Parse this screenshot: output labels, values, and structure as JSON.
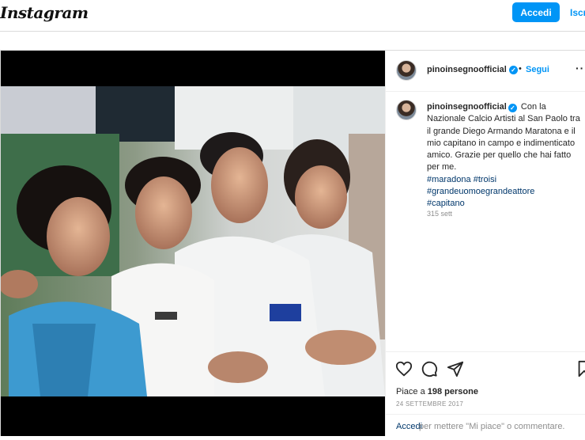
{
  "header": {
    "logo": "Instagram",
    "login_button": "Accedi",
    "signup_link": "Iscr"
  },
  "post": {
    "username": "pinoinsegnoofficial",
    "verified_mark": "✓",
    "dot": "•",
    "follow_label": "Segui",
    "more_label": "···",
    "caption": {
      "username": "pinoinsegnoofficial",
      "text": "Con la Nazionale Calcio Artisti al San Paolo tra il grande Diego Armando Maratona e il mio capitano in campo e indimenticato amico. Grazie per quello che hai fatto per me.",
      "hashtags": [
        "#maradona #troisi",
        "#grandeuomoegrandeattore",
        "#capitano"
      ],
      "time_ago": "315 sett"
    },
    "likes": {
      "prefix": "Piace a ",
      "count": "198 persone"
    },
    "date": "24 SETTEMBRE 2017",
    "login_prompt": {
      "link": "Accedi",
      "text": "per mettere \"Mi piace\" o commentare."
    }
  },
  "icons": {
    "like": "heart-icon",
    "comment": "comment-icon",
    "share": "paper-plane-icon",
    "save": "bookmark-icon"
  },
  "colors": {
    "accent": "#0095f6",
    "link": "#00376b",
    "muted": "#8e8e8e",
    "border": "#dbdbdb"
  }
}
